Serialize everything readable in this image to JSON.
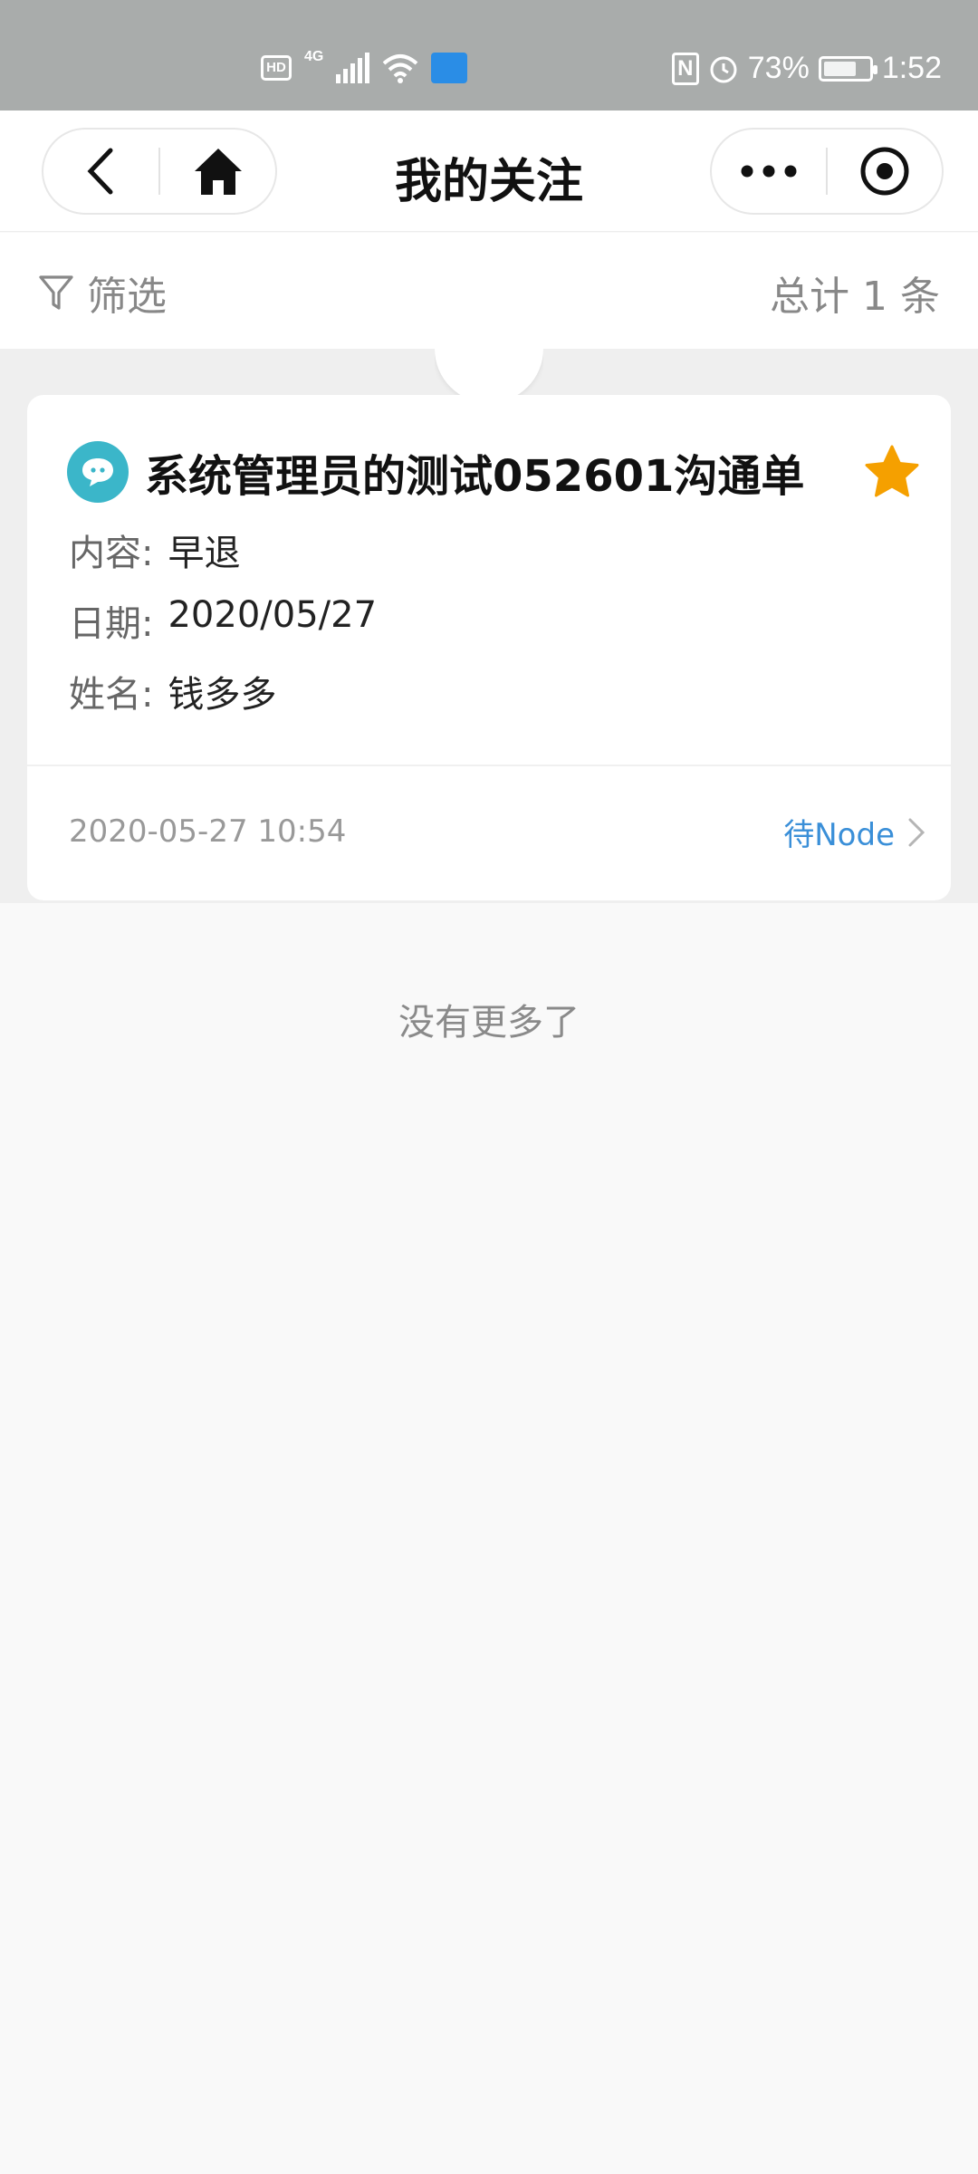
{
  "status_bar": {
    "hd": "HD",
    "network": "4G",
    "nfc": "N",
    "battery": "73%",
    "time": "1:52",
    "battery_level": 0.73
  },
  "header": {
    "title": "我的关注",
    "icons": [
      "back-icon",
      "home-icon",
      "more-icon",
      "close-target-icon"
    ]
  },
  "filter_bar": {
    "filter_label": "筛选",
    "total": "总计 1 条"
  },
  "card": {
    "title": "系统管理员的测试052601沟通单",
    "fields": [
      {
        "label": "内容:",
        "value": "早退"
      },
      {
        "label": "日期:",
        "value": "2020/05/27"
      },
      {
        "label": "姓名:",
        "value": "钱多多"
      }
    ],
    "timestamp": "2020-05-27 10:54",
    "status": "待Node",
    "colors": {
      "badge": "#3bb6c9",
      "star": "#f5a000",
      "status": "#3a8fd8"
    }
  },
  "footer": {
    "no_more": "没有更多了"
  }
}
